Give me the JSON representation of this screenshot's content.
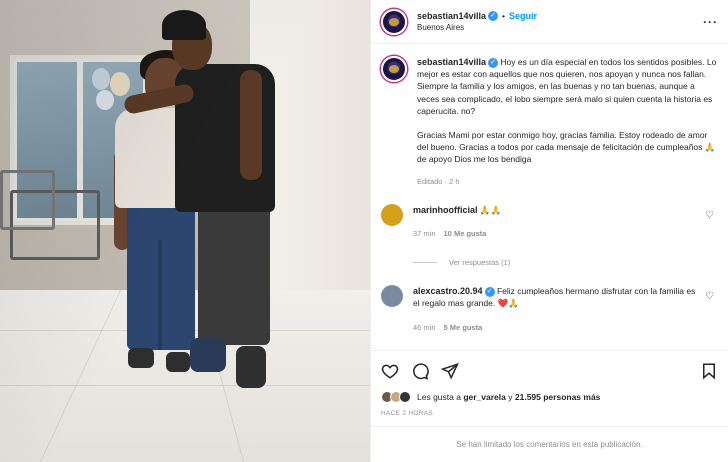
{
  "post": {
    "username": "sebastian14villa",
    "follow_label": "Seguir",
    "location": "Buenos Aires",
    "verified": true
  },
  "caption": {
    "username": "sebastian14villa",
    "text": "Hoy es un día especial en todos los sentidos posibles. Lo mejor es estar con aquellos que nos quieren, nos apoyan y nunca nos fallan. Siempre la familia y los amigos, en las buenas y no tan buenas, aunque a veces sea complicado, el lobo siempre será malo si quien cuenta la historia es caperucita. no?",
    "text2": "Gracias Mami por estar conmigo hoy, gracias familia. Estoy rodeado de amor del bueno. Gracias a todos por cada mensaje de felicitación de cumpleaños 🙏 de apoyo Dios me los bendiga",
    "edited": "Editado · 2 h"
  },
  "comments": [
    {
      "username": "marinhoofficial",
      "text": "🙏🙏",
      "time": "37 min",
      "likes": "10 Me gusta",
      "avatar_color": "#d4a017"
    },
    {
      "username": "alexcastro.20.94",
      "text": "Feliz cumpleaños hermano disfrutar con la familia es el regalo mas grande. ❤️🙏",
      "time": "46 min",
      "likes": "5 Me gusta",
      "avatar_color": "#7b8aa0"
    }
  ],
  "replies_label": "Ver respuestas (1)",
  "likes": {
    "prefix": "Les gusta a ",
    "user": "ger_varela",
    "middle": " y ",
    "count": "21.595 personas más"
  },
  "time_ago": "HACE 2 HORAS",
  "comments_limited": "Se han limitado los comentarios en esta publicación.",
  "colors": {
    "link": "#0095f6",
    "verified": "#3897f0",
    "muted": "#8e8e8e"
  }
}
